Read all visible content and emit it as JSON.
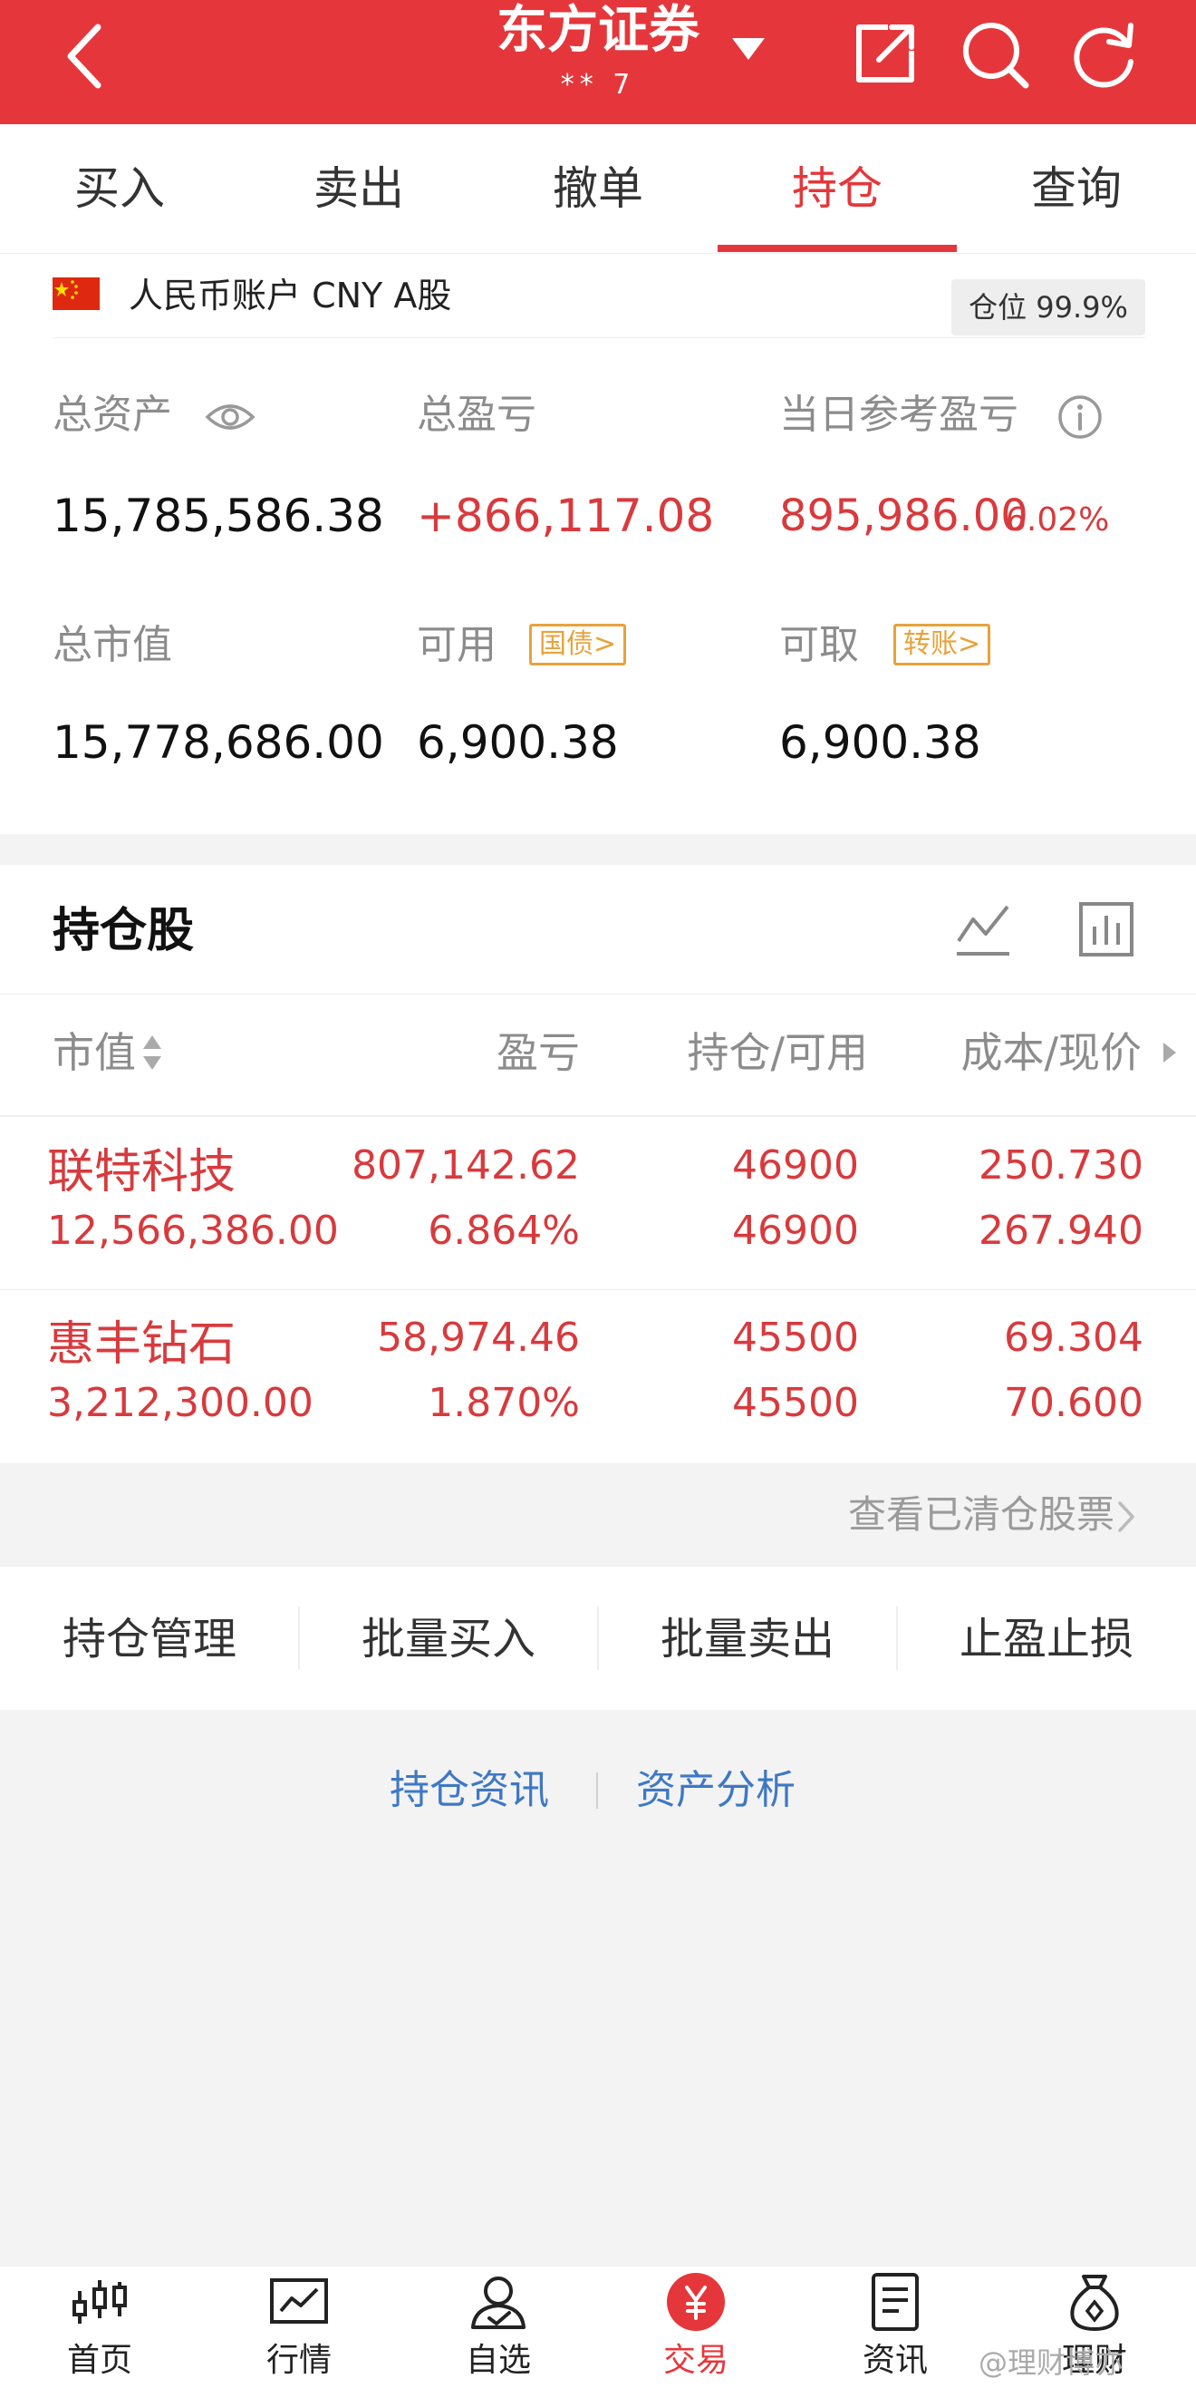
{
  "header": {
    "title": "东方证券",
    "subtitle": "** 7"
  },
  "tabs": [
    {
      "label": "买入"
    },
    {
      "label": "卖出"
    },
    {
      "label": "撤单"
    },
    {
      "label": "持仓",
      "active": true
    },
    {
      "label": "查询"
    }
  ],
  "account": {
    "name": "人民币账户 CNY A股",
    "position_label": "仓位 99.9%"
  },
  "summary": {
    "total_assets_label": "总资产",
    "total_assets": "15,785,586.38",
    "total_pnl_label": "总盈亏",
    "total_pnl": "+866,117.08",
    "daily_pnl_label": "当日参考盈亏",
    "daily_pnl": "895,986.00",
    "daily_pnl_pct": "6.02%",
    "market_value_label": "总市值",
    "market_value": "15,778,686.00",
    "available_label": "可用",
    "available_tag": "国债>",
    "available": "6,900.38",
    "withdrawable_label": "可取",
    "withdrawable_tag": "转账>",
    "withdrawable": "6,900.38"
  },
  "holdings": {
    "title": "持仓股",
    "columns": [
      "市值",
      "盈亏",
      "持仓/可用",
      "成本/现价"
    ],
    "rows": [
      {
        "name": "联特科技",
        "market_value": "12,566,386.00",
        "pnl": "807,142.62",
        "pnl_pct": "6.864%",
        "position": "46900",
        "available": "46900",
        "cost": "250.730",
        "price": "267.940"
      },
      {
        "name": "惠丰钻石",
        "market_value": "3,212,300.00",
        "pnl": "58,974.46",
        "pnl_pct": "1.870%",
        "position": "45500",
        "available": "45500",
        "cost": "69.304",
        "price": "70.600"
      }
    ],
    "cleared_link": "查看已清仓股票"
  },
  "actions": [
    "持仓管理",
    "批量买入",
    "批量卖出",
    "止盈止损"
  ],
  "links": [
    "持仓资讯",
    "资产分析"
  ],
  "bottom_nav": [
    {
      "label": "首页",
      "icon": "candlestick-icon"
    },
    {
      "label": "行情",
      "icon": "market-chart-icon"
    },
    {
      "label": "自选",
      "icon": "person-check-icon"
    },
    {
      "label": "交易",
      "icon": "yen-icon",
      "active": true
    },
    {
      "label": "资讯",
      "icon": "document-icon"
    },
    {
      "label": "理财",
      "icon": "money-bag-icon"
    }
  ],
  "watermark": "@理财博亦",
  "colors": {
    "brand_red": "#e5373b",
    "profit_red": "#d83a3d",
    "link_blue": "#3e78c5",
    "tag_orange": "#e8a23a"
  }
}
